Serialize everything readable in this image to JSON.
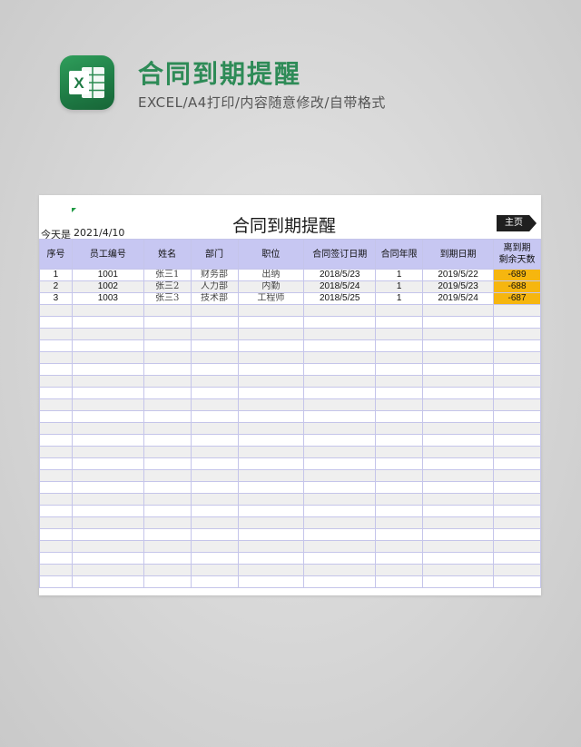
{
  "header": {
    "title": "合同到期提醒",
    "subtitle": "EXCEL/A4打印/内容随意修改/自带格式",
    "logo_icon": "excel-logo-icon",
    "logo_letter": "X"
  },
  "sheet": {
    "title": "合同到期提醒",
    "today_label": "今天是",
    "today_value": "2021/4/10",
    "home_button": "主页",
    "columns": [
      "序号",
      "员工编号",
      "姓名",
      "部门",
      "职位",
      "合同签订日期",
      "合同年限",
      "到期日期",
      "离到期\n剩余天数"
    ],
    "rows": [
      {
        "no": "1",
        "emp_id": "1001",
        "name": "张三1",
        "dept": "财务部",
        "pos": "出纳",
        "sign_date": "2018/5/23",
        "years": "1",
        "due_date": "2019/5/22",
        "remain": "-689"
      },
      {
        "no": "2",
        "emp_id": "1002",
        "name": "张三2",
        "dept": "人力部",
        "pos": "内勤",
        "sign_date": "2018/5/24",
        "years": "1",
        "due_date": "2019/5/23",
        "remain": "-688"
      },
      {
        "no": "3",
        "emp_id": "1003",
        "name": "张三3",
        "dept": "技术部",
        "pos": "工程师",
        "sign_date": "2018/5/25",
        "years": "1",
        "due_date": "2019/5/24",
        "remain": "-687"
      }
    ],
    "empty_rows": 24,
    "colors": {
      "header_bg": "#c7c7f2",
      "grid_line": "#c5c5ea",
      "alert": "#f6b60f",
      "brand_green": "#2e8b57"
    }
  }
}
